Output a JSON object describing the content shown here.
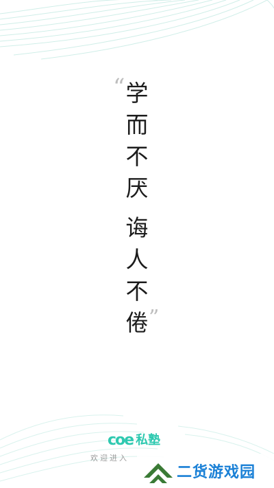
{
  "quote": {
    "open_mark": "“",
    "close_mark": "”",
    "line1": [
      "学",
      "而",
      "不",
      "厌"
    ],
    "line2": [
      "诲",
      "人",
      "不",
      "倦"
    ]
  },
  "brand": {
    "logo_text": "coe",
    "name": "私塾"
  },
  "welcome_text": "欢迎进入",
  "watermark": {
    "text": "二货游戏园"
  },
  "colors": {
    "accent": "#2ec9b0",
    "watermark_blue": "#1a80d6",
    "watermark_green": "#3a7a35",
    "text": "#1c1c1c",
    "muted": "#9a9a9a"
  }
}
